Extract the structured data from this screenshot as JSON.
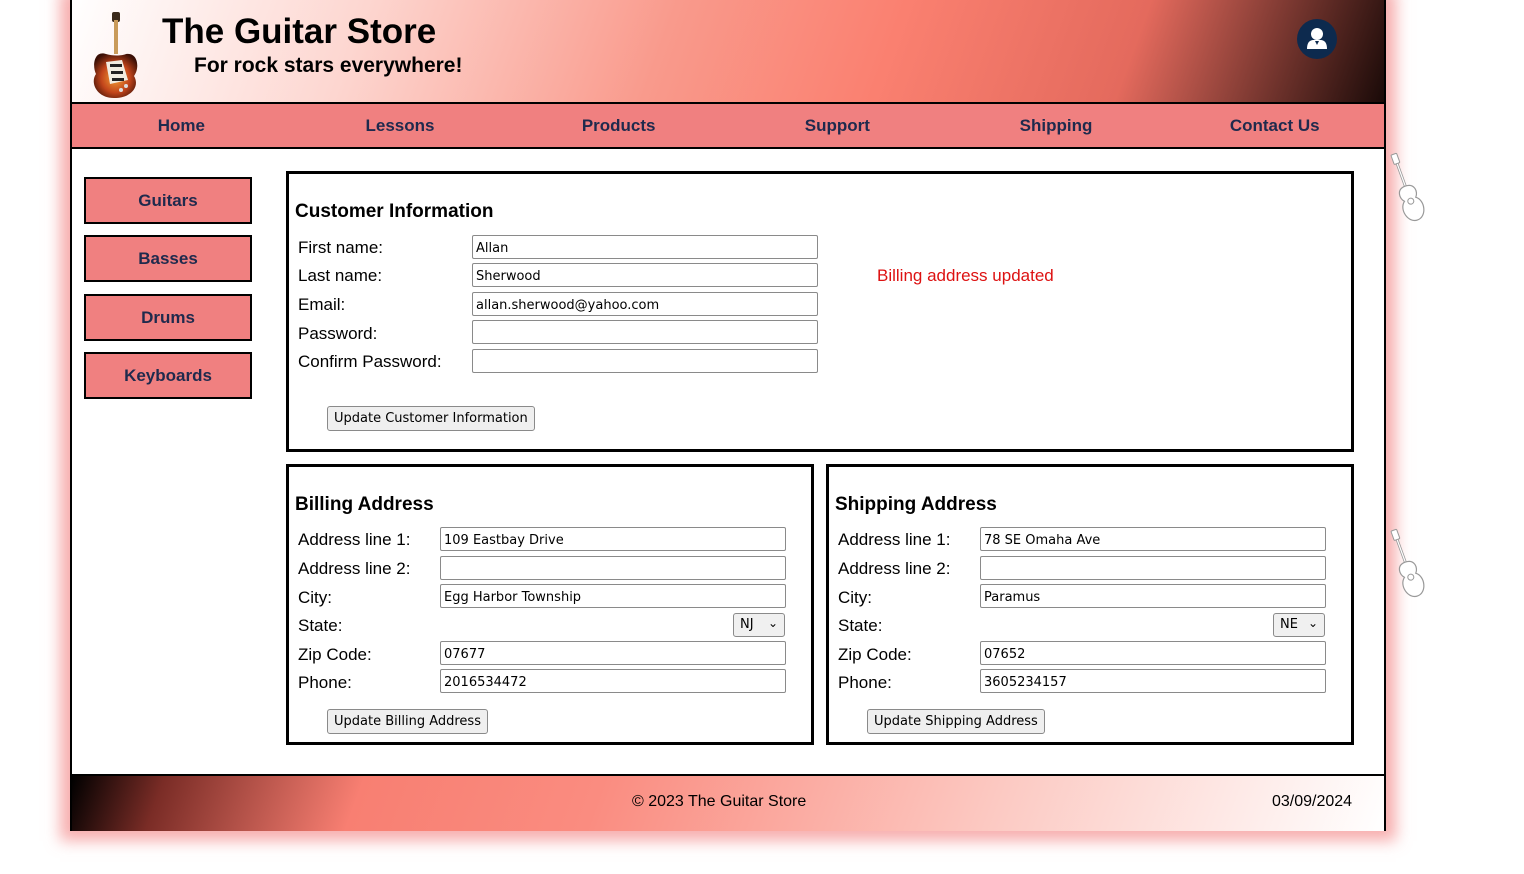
{
  "header": {
    "title": "The Guitar Store",
    "subtitle": "For rock stars everywhere!"
  },
  "nav": {
    "items": [
      {
        "label": "Home"
      },
      {
        "label": "Lessons"
      },
      {
        "label": "Products"
      },
      {
        "label": "Support"
      },
      {
        "label": "Shipping"
      },
      {
        "label": "Contact Us"
      }
    ]
  },
  "sidebar": {
    "items": [
      {
        "label": "Guitars"
      },
      {
        "label": "Basses"
      },
      {
        "label": "Drums"
      },
      {
        "label": "Keyboards"
      }
    ]
  },
  "customer": {
    "title": "Customer Information",
    "status_message": "Billing address updated",
    "first_name": {
      "label": "First name:",
      "value": "Allan"
    },
    "last_name": {
      "label": "Last name:",
      "value": "Sherwood"
    },
    "email": {
      "label": "Email:",
      "value": "allan.sherwood@yahoo.com"
    },
    "password": {
      "label": "Password:",
      "value": ""
    },
    "confirm_password": {
      "label": "Confirm Password:",
      "value": ""
    },
    "update_button": "Update Customer Information"
  },
  "billing": {
    "title": "Billing Address",
    "line1": {
      "label": "Address line 1:",
      "value": "109 Eastbay Drive"
    },
    "line2": {
      "label": "Address line 2:",
      "value": ""
    },
    "city": {
      "label": "City:",
      "value": "Egg Harbor Township"
    },
    "state": {
      "label": "State:",
      "value": "NJ"
    },
    "zip": {
      "label": "Zip Code:",
      "value": "07677"
    },
    "phone": {
      "label": "Phone:",
      "value": "2016534472"
    },
    "update_button": "Update Billing Address"
  },
  "shipping": {
    "title": "Shipping Address",
    "line1": {
      "label": "Address line 1:",
      "value": "78 SE Omaha Ave"
    },
    "line2": {
      "label": "Address line 2:",
      "value": ""
    },
    "city": {
      "label": "City:",
      "value": "Paramus"
    },
    "state": {
      "label": "State:",
      "value": "NE"
    },
    "zip": {
      "label": "Zip Code:",
      "value": "07652"
    },
    "phone": {
      "label": "Phone:",
      "value": "3605234157"
    },
    "update_button": "Update Shipping Address"
  },
  "footer": {
    "copyright": "© 2023 The Guitar Store",
    "date": "03/09/2024"
  },
  "icons": {
    "user": "user-icon",
    "logo": "electric-guitar-logo",
    "decoration": "acoustic-guitar-icon",
    "select_chevron": "chevron-down-icon"
  },
  "colors": {
    "nav_background": "#f08080",
    "nav_text": "#1f2a4d",
    "status_error": "#dd1111",
    "user_button": "#0d2a4e"
  }
}
